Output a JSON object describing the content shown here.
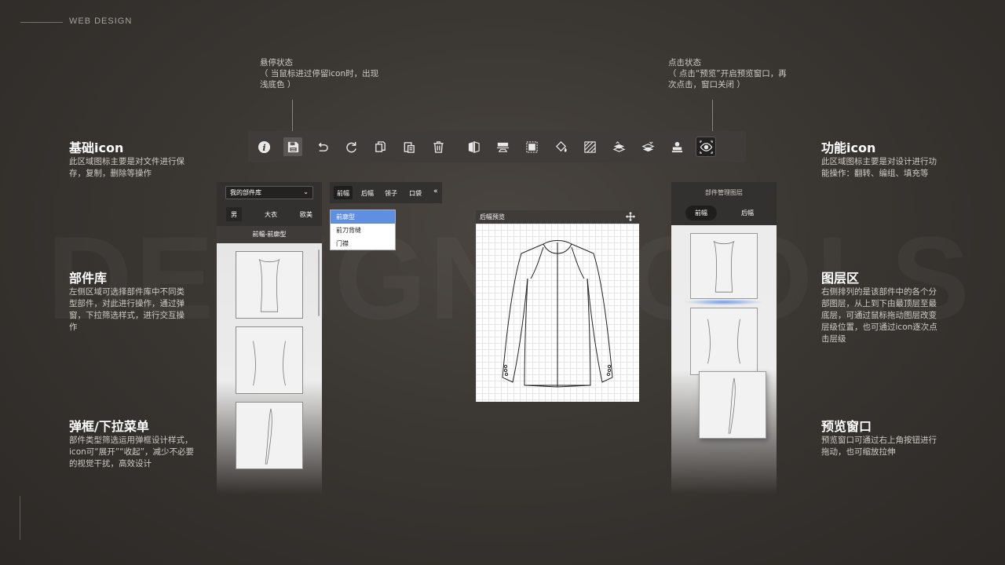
{
  "brand": {
    "label": "WEB DESIGN"
  },
  "watermark": {
    "text": "DESIGN TOOLS"
  },
  "sections": {
    "basic": {
      "title": "基础icon",
      "desc": "此区域图标主要是对文件进行保存，复制，删除等操作"
    },
    "library": {
      "title": "部件库",
      "desc": "左侧区域可选择部件库中不同类型部件，对此进行操作，通过弹窗，下拉筛选样式，进行交互操作"
    },
    "popup": {
      "title": "弹框/下拉菜单",
      "desc": "部件类型筛选运用弹框设计样式，icon可“展开”“收起”，减少不必要的视觉干扰，高效设计"
    },
    "function": {
      "title": "功能icon",
      "desc": "此区域图标主要是对设计进行功能操作：翻转、编组、填充等"
    },
    "layers": {
      "title": "图层区",
      "desc": "右侧排列的是该部件中的各个分部图层，从上到下由最顶层至最底层，可通过鼠标拖动图层改变层级位置，也可通过icon逐次点击层级"
    },
    "preview": {
      "title": "预览窗口",
      "desc": "预览窗口可通过右上角按钮进行拖动，也可缩放拉伸"
    }
  },
  "callouts": {
    "hover": {
      "title": "悬停状态",
      "desc": "（ 当鼠标进过停留icon时，出现浅底色 ）"
    },
    "click": {
      "title": "点击状态",
      "desc": "（ 点击“预览”开启预览窗口，再次点击，窗口关闭 ）"
    }
  },
  "toolbar": {
    "icons": [
      "info-icon",
      "save-icon",
      "undo-icon",
      "redo-icon",
      "copy-icon",
      "paste-icon",
      "delete-icon",
      "flip-icon",
      "align-icon",
      "group-icon",
      "fill-icon",
      "pattern-icon",
      "layer-up-icon",
      "layer-down-icon",
      "stamp-icon",
      "preview-eye-icon"
    ]
  },
  "library": {
    "select_value": "我的部件库",
    "filters": [
      "男",
      "大衣",
      "欧美"
    ],
    "header": "前幅-前廓型"
  },
  "parts_tabs": {
    "tabs": [
      "前幅",
      "后幅",
      "领子",
      "口袋"
    ],
    "collapse": "«",
    "dropdown": [
      "前廓型",
      "前刀背缝",
      "门襟"
    ]
  },
  "preview": {
    "title": "后幅预览"
  },
  "layer_panel": {
    "title": "部件管理图层",
    "tabs": [
      "前幅",
      "后幅"
    ]
  },
  "colors": {
    "accent": "#5f8fe0",
    "background": "#3a3632",
    "panel": "#333130"
  }
}
